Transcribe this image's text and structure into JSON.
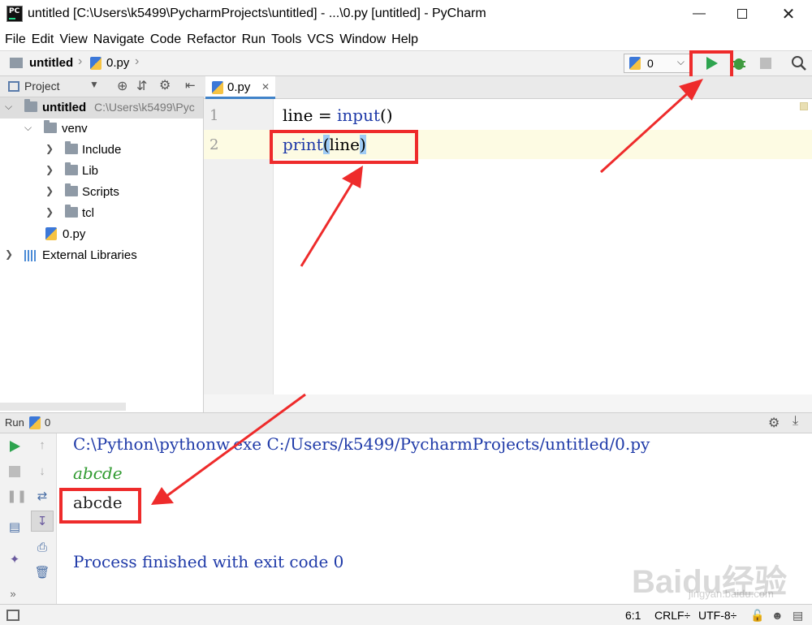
{
  "window": {
    "title": "untitled [C:\\Users\\k5499\\PycharmProjects\\untitled] - ...\\0.py [untitled] - PyCharm",
    "app_badge": "PC"
  },
  "menu": [
    "File",
    "Edit",
    "View",
    "Navigate",
    "Code",
    "Refactor",
    "Run",
    "Tools",
    "VCS",
    "Window",
    "Help"
  ],
  "breadcrumb": {
    "project": "untitled",
    "file": "0.py"
  },
  "run_config": {
    "label": "0"
  },
  "project_panel": {
    "title": "Project",
    "tree": [
      {
        "label": "untitled",
        "path": "C:\\Users\\k5499\\Pyc"
      },
      {
        "label": "venv"
      },
      {
        "label": "Include"
      },
      {
        "label": "Lib"
      },
      {
        "label": "Scripts"
      },
      {
        "label": "tcl"
      },
      {
        "label": "0.py"
      },
      {
        "label": "External Libraries"
      }
    ]
  },
  "editor": {
    "tab": "0.py",
    "lines": [
      {
        "number": "1",
        "var": "line",
        "op": " = ",
        "call": "input",
        "parens": "()"
      },
      {
        "number": "2",
        "call": "print",
        "open": "(",
        "arg": "line",
        "close": ")"
      }
    ]
  },
  "run_panel": {
    "title": "Run",
    "tab": "0",
    "console": {
      "command": "C:\\Python\\pythonw.exe C:/Users/k5499/PycharmProjects/untitled/0.py",
      "input_echo": "abcde",
      "output": "abcde",
      "finished": "Process finished with exit code 0"
    }
  },
  "status_bar": {
    "position": "6:1",
    "line_sep": "CRLF÷",
    "encoding": "UTF-8÷"
  },
  "watermark": {
    "text": "Baidu经验",
    "sub": "jingyan.baidu.com"
  },
  "colors": {
    "run_green": "#2ea44f",
    "highlight_red": "#ee2b2b",
    "keyword_blue": "#1f3aa8",
    "console_green": "#2f9a2f",
    "console_blue": "#1f3aa8"
  }
}
